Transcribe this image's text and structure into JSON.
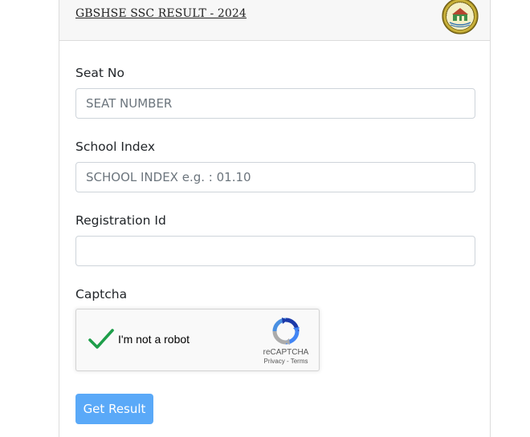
{
  "header": {
    "title": "GBSHSE SSC RESULT - 2024",
    "logo_icon": "gbshse-seal-logo"
  },
  "form": {
    "seat_no": {
      "label": "Seat No",
      "placeholder": "SEAT NUMBER",
      "value": ""
    },
    "school_index": {
      "label": "School Index",
      "placeholder": "SCHOOL INDEX e.g. : 01.10",
      "value": ""
    },
    "registration_id": {
      "label": "Registration Id",
      "placeholder": "",
      "value": ""
    },
    "captcha": {
      "label": "Captcha",
      "checkbox_text": "I'm not a robot",
      "checked": true,
      "brand": "reCAPTCHA",
      "privacy_link": "Privacy",
      "separator": " - ",
      "terms_link": "Terms"
    },
    "submit_label": "Get Result"
  },
  "colors": {
    "button_bg": "#5aa9f8",
    "check_green": "#1e9e4a",
    "header_bg": "#f7f7f7"
  }
}
